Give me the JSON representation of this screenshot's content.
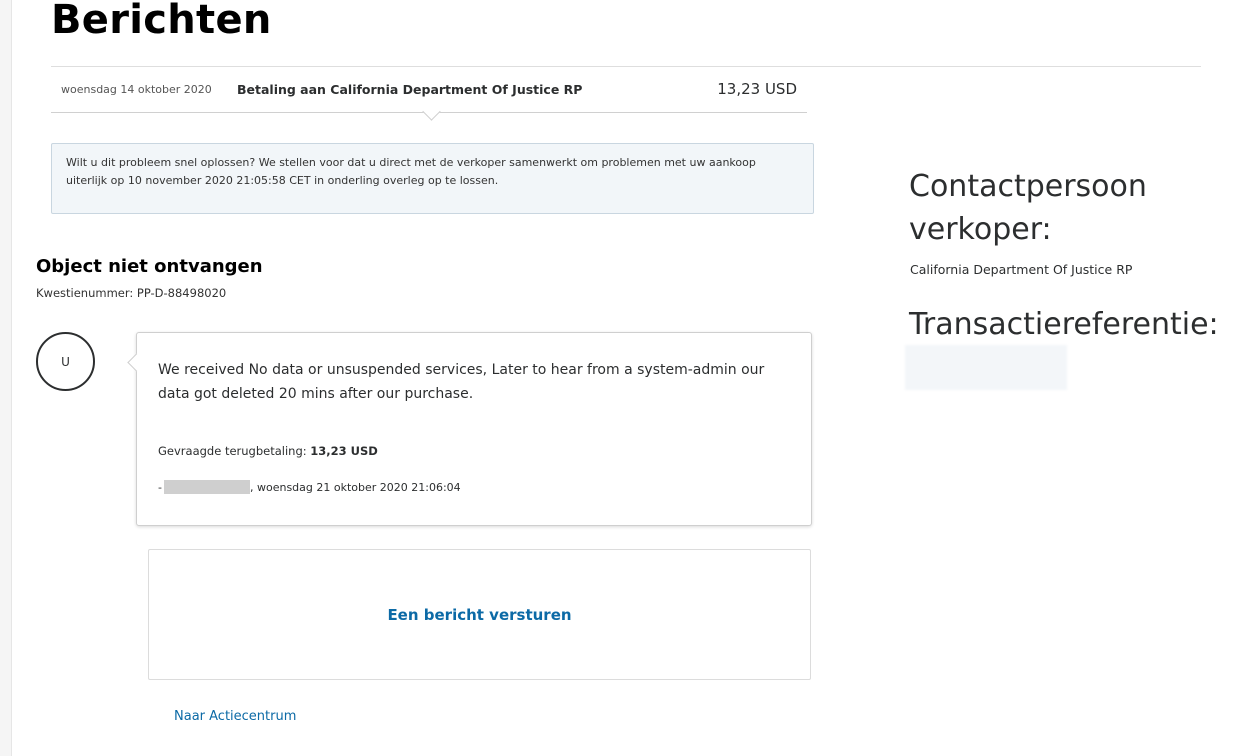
{
  "page": {
    "title": "Berichten"
  },
  "transaction": {
    "date": "woensdag 14 oktober 2020",
    "description": "Betaling aan California Department Of Justice RP",
    "amount": "13,23 USD"
  },
  "notice": {
    "text": "Wilt u dit probleem snel oplossen? We stellen voor dat u direct met de verkoper samenwerkt om problemen met uw aankoop uiterlijk op 10 november 2020 21:05:58 CET in onderling overleg op te lossen."
  },
  "case": {
    "title": "Object niet ontvangen",
    "id_label": "Kwestienummer: PP-D-88498020"
  },
  "message": {
    "avatar_initial": "U",
    "body": "We received No data or unsuspended services, Later to hear from a system-admin our data got deleted 20 mins after our purchase.",
    "refund_label": "Gevraagde terugbetaling: ",
    "refund_amount": "13,23 USD",
    "author_prefix": "-",
    "timestamp": ", woensdag 21 oktober 2020 21:06:04"
  },
  "actions": {
    "send_message": "Een bericht versturen",
    "back_link": "Naar Actiecentrum"
  },
  "sidebar": {
    "contact_heading": "Contactpersoon verkoper:",
    "contact_name": "California Department Of Justice RP",
    "reference_heading": "Transactiereferentie:"
  }
}
